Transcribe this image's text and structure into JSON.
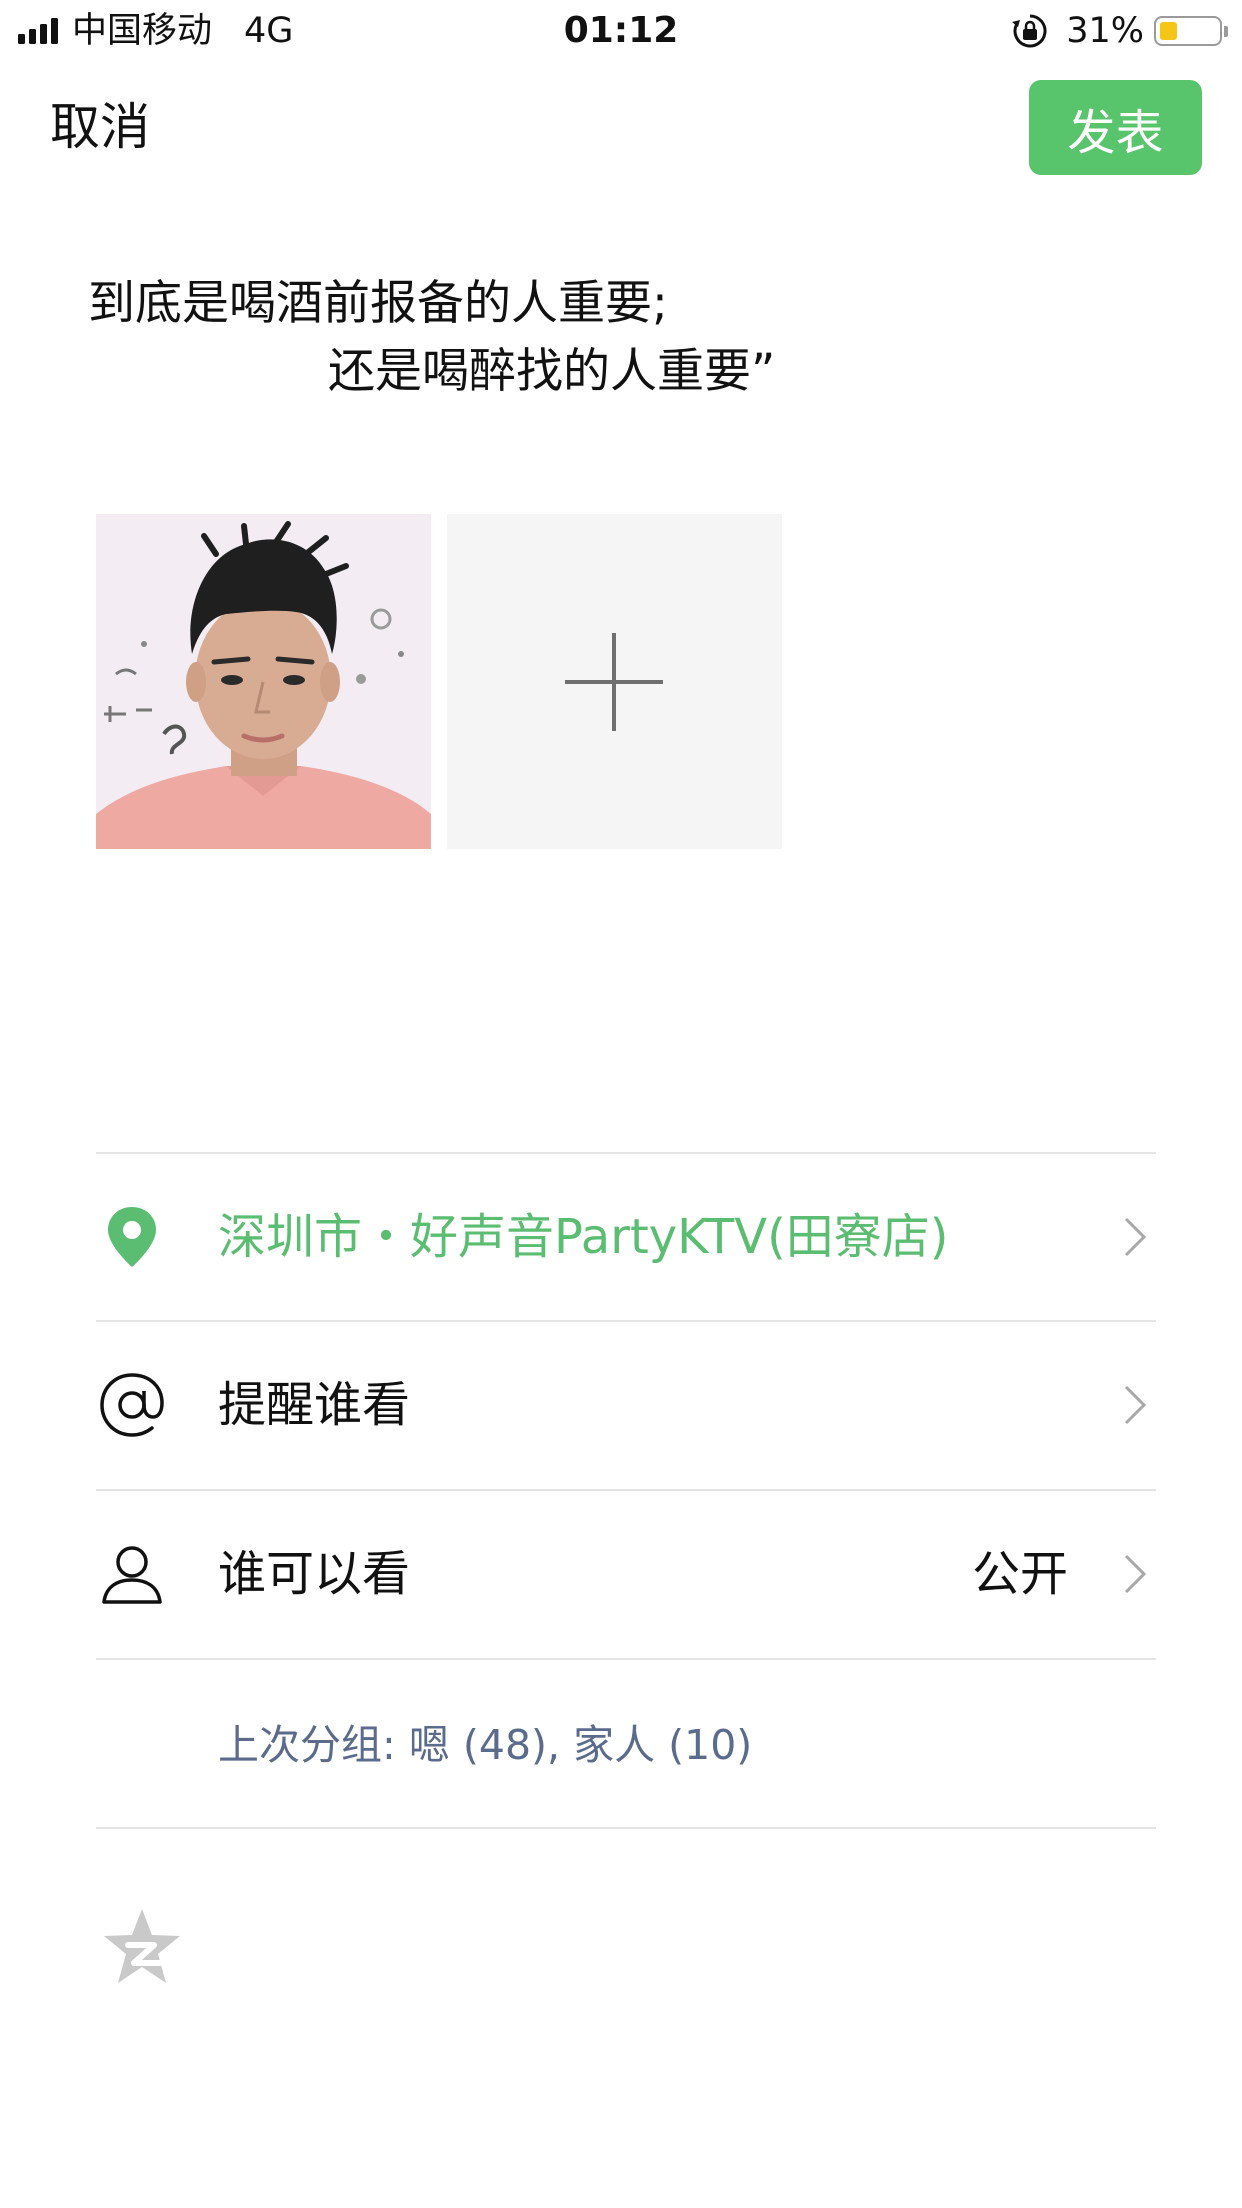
{
  "status_bar": {
    "carrier": "中国移动",
    "network": "4G",
    "time": "01:12",
    "battery_percent": "31%",
    "battery_level": 0.31,
    "battery_color": "#f5c518"
  },
  "nav": {
    "cancel_label": "取消",
    "publish_label": "发表",
    "publish_color": "#58c46c"
  },
  "post": {
    "line1": "到底是喝酒前报备的人重要;",
    "line2": "还是喝醉找的人重要”"
  },
  "images": {
    "photo_icon": "person-photo",
    "add_icon": "plus-icon"
  },
  "options": {
    "location": {
      "icon": "location-pin-icon",
      "label": "深圳市・好声音PartyKTV(田寮店)",
      "color": "#5bbd72"
    },
    "remind": {
      "icon": "at-sign-icon",
      "label": "提醒谁看"
    },
    "visibility": {
      "icon": "person-icon",
      "label": "谁可以看",
      "value": "公开"
    },
    "last_group": "上次分组:  嗯 (48), 家人 (10)"
  },
  "share": {
    "icon": "qzone-star-icon"
  }
}
